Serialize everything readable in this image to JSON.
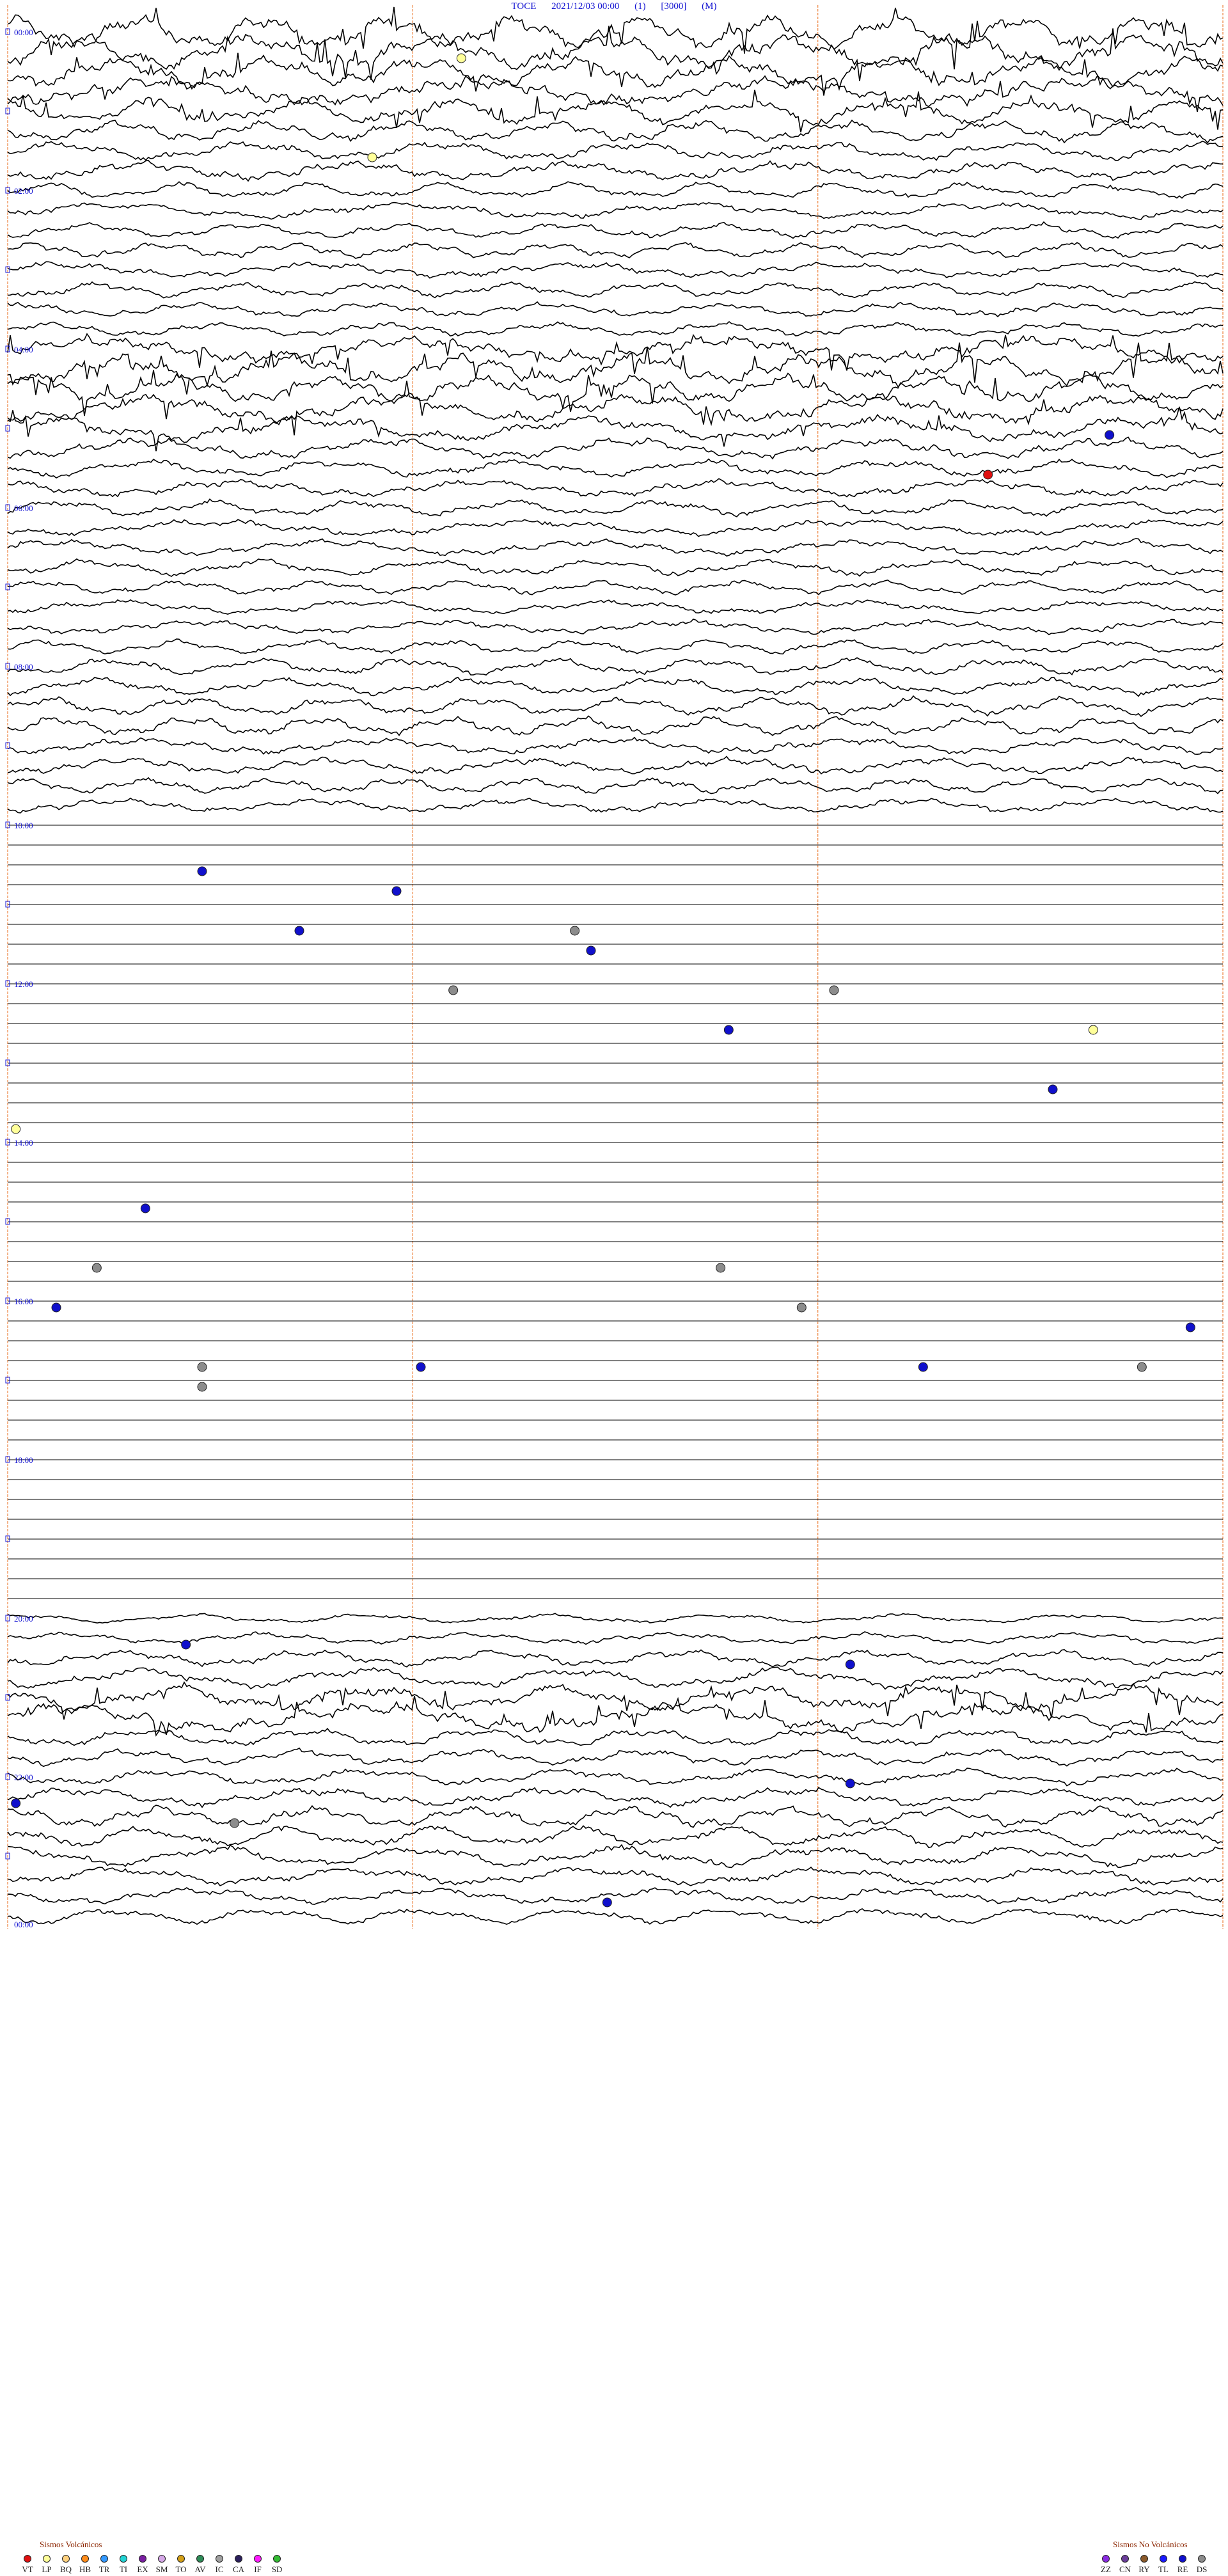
{
  "header": {
    "station": "TOCE",
    "datetime": "2021/12/03 00:00",
    "component": "(1)",
    "gain": "[3000]",
    "unit": "(M)"
  },
  "chart_data": {
    "type": "seismogram",
    "title": "TOCE 2021/12/03 00:00 (1) [3000] (M)",
    "rows": 96,
    "minutes_per_row": 15,
    "hour_labels": [
      "00:00",
      "02:00",
      "04:00",
      "06:00",
      "08:00",
      "10:00",
      "12:00",
      "14:00",
      "16:00",
      "18:00",
      "20:00",
      "22:00",
      "00:00"
    ],
    "minute_marks": [
      5,
      10,
      15
    ],
    "activity_by_row": [
      3,
      3,
      2.6,
      2.4,
      2.2,
      1.8,
      1.6,
      1.6,
      1.4,
      1.4,
      1.3,
      1.3,
      1.3,
      1.3,
      1.2,
      1.2,
      2.2,
      2.6,
      2.4,
      2.4,
      2.2,
      1.8,
      1.5,
      1.5,
      1.4,
      1.4,
      1.4,
      1.4,
      1.2,
      1.2,
      1.2,
      1.2,
      1.5,
      1.5,
      1.6,
      1.6,
      1.4,
      1.4,
      1.3,
      1.2,
      0,
      0,
      0,
      0,
      0,
      0,
      0,
      0,
      0,
      0,
      0,
      0,
      0,
      0,
      0,
      0,
      0,
      0,
      0,
      0,
      0,
      0,
      0,
      0,
      0,
      0,
      0,
      0,
      0,
      0,
      0,
      0,
      0,
      0,
      0,
      0,
      0,
      0,
      0,
      0,
      0.8,
      1.0,
      1.4,
      1.8,
      2.2,
      2.4,
      1.6,
      1.4,
      1.4,
      1.6,
      1.8,
      1.8,
      1.8,
      1.6,
      1.4,
      1.4
    ],
    "events": [
      {
        "row": 1,
        "minute": 5.6,
        "type": "LP"
      },
      {
        "row": 6,
        "minute": 4.5,
        "type": "LP"
      },
      {
        "row": 20,
        "minute": 13.6,
        "type": "RE"
      },
      {
        "row": 22,
        "minute": 12.1,
        "type": "VT"
      },
      {
        "row": 42,
        "minute": 2.4,
        "type": "RE"
      },
      {
        "row": 43,
        "minute": 4.8,
        "type": "RE"
      },
      {
        "row": 45,
        "minute": 3.6,
        "type": "RE"
      },
      {
        "row": 45,
        "minute": 7.0,
        "type": "DS"
      },
      {
        "row": 46,
        "minute": 7.2,
        "type": "RE"
      },
      {
        "row": 48,
        "minute": 5.5,
        "type": "DS"
      },
      {
        "row": 48,
        "minute": 10.2,
        "type": "DS"
      },
      {
        "row": 50,
        "minute": 8.9,
        "type": "RE"
      },
      {
        "row": 50,
        "minute": 13.4,
        "type": "LP"
      },
      {
        "row": 53,
        "minute": 12.9,
        "type": "RE"
      },
      {
        "row": 55,
        "minute": 0.1,
        "type": "LP"
      },
      {
        "row": 59,
        "minute": 1.7,
        "type": "RE"
      },
      {
        "row": 62,
        "minute": 1.1,
        "type": "DS"
      },
      {
        "row": 62,
        "minute": 8.8,
        "type": "DS"
      },
      {
        "row": 64,
        "minute": 0.6,
        "type": "RE"
      },
      {
        "row": 64,
        "minute": 9.8,
        "type": "DS"
      },
      {
        "row": 65,
        "minute": 14.6,
        "type": "RE"
      },
      {
        "row": 67,
        "minute": 2.4,
        "type": "DS"
      },
      {
        "row": 67,
        "minute": 5.1,
        "type": "RE"
      },
      {
        "row": 67,
        "minute": 11.3,
        "type": "RE"
      },
      {
        "row": 67,
        "minute": 14.0,
        "type": "DS"
      },
      {
        "row": 68,
        "minute": 2.4,
        "type": "DS"
      },
      {
        "row": 81,
        "minute": 2.2,
        "type": "RE"
      },
      {
        "row": 82,
        "minute": 10.4,
        "type": "RE"
      },
      {
        "row": 88,
        "minute": 10.4,
        "type": "RE"
      },
      {
        "row": 89,
        "minute": 0.1,
        "type": "RE"
      },
      {
        "row": 90,
        "minute": 2.8,
        "type": "DS"
      },
      {
        "row": 94,
        "minute": 7.4,
        "type": "RE"
      }
    ]
  },
  "legend": {
    "volcanic_title": "Sismos Volcánicos",
    "non_volcanic_title": "Sismos No Volcánicos",
    "volcanic": [
      {
        "code": "VT",
        "color": "#e01010"
      },
      {
        "code": "LP",
        "color": "#ffff99"
      },
      {
        "code": "BQ",
        "color": "#ffd27f"
      },
      {
        "code": "HB",
        "color": "#ff8c1a"
      },
      {
        "code": "TR",
        "color": "#3399ff"
      },
      {
        "code": "TI",
        "color": "#22d3d3"
      },
      {
        "code": "EX",
        "color": "#7a1fa2"
      },
      {
        "code": "SM",
        "color": "#d6a8e8"
      },
      {
        "code": "TO",
        "color": "#d4a017"
      },
      {
        "code": "AV",
        "color": "#2e8b57"
      },
      {
        "code": "IC",
        "color": "#a0a0a0"
      },
      {
        "code": "CA",
        "color": "#2b1f5c"
      },
      {
        "code": "IF",
        "color": "#ff1aff"
      },
      {
        "code": "SD",
        "color": "#33bb33"
      }
    ],
    "non_volcanic": [
      {
        "code": "ZZ",
        "color": "#8a2be2"
      },
      {
        "code": "CN",
        "color": "#6a3d9a"
      },
      {
        "code": "RY",
        "color": "#8b5a2b"
      },
      {
        "code": "TL",
        "color": "#1a1aff"
      },
      {
        "code": "RE",
        "color": "#1010cc"
      },
      {
        "code": "DS",
        "color": "#8c8c8c"
      }
    ]
  }
}
